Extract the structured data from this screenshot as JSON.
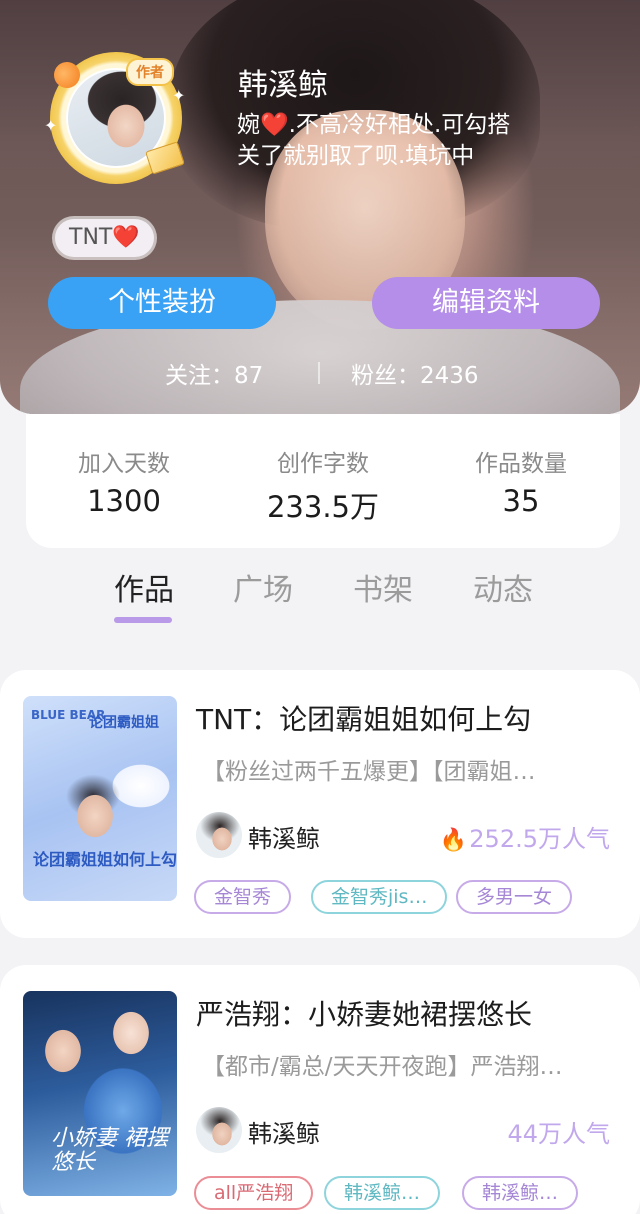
{
  "profile": {
    "name": "韩溪鲸",
    "avatar_badge": "作者",
    "bio_line1": "婉❤️.不高冷好相处.可勾搭",
    "bio_line2": "关了就别取了呗.填坑中",
    "tag_text": "TNT",
    "tag_heart": "❤️",
    "following": "关注：87",
    "fans": "粉丝：2436"
  },
  "buttons": {
    "decorate": "个性装扮",
    "edit": "编辑资料"
  },
  "stats": [
    {
      "label": "加入天数",
      "value": "1300"
    },
    {
      "label": "创作字数",
      "value": "233.5万"
    },
    {
      "label": "作品数量",
      "value": "35"
    }
  ],
  "tabs": [
    "作品",
    "广场",
    "书架",
    "动态"
  ],
  "works": [
    {
      "title": "TNT：论团霸姐姐如何上勾",
      "desc": "【粉丝过两千五爆更】【团霸姐…",
      "author": "韩溪鲸",
      "popularity": "252.5万人气",
      "tags": [
        "金智秀",
        "金智秀jis…",
        "多男一女"
      ],
      "cover_text": [
        "BLUE BEAR",
        "论团霸姐姐",
        "论团霸姐姐如何上勾"
      ]
    },
    {
      "title": "严浩翔：小娇妻她裙摆悠长",
      "desc": "【都市/霸总/天天开夜跑】严浩翔…",
      "author": "韩溪鲸",
      "popularity": "44万人气",
      "tags": [
        "all严浩翔",
        "韩溪鲸…",
        "韩溪鲸…"
      ],
      "cover_text": [
        "小娇妻 裙摆悠长"
      ]
    }
  ],
  "colors": {
    "accent_blue": "#3aa2f4",
    "accent_purple": "#b48ee8",
    "popularity": "#c1a8ec",
    "tab_indicator": "#b89ae8"
  }
}
